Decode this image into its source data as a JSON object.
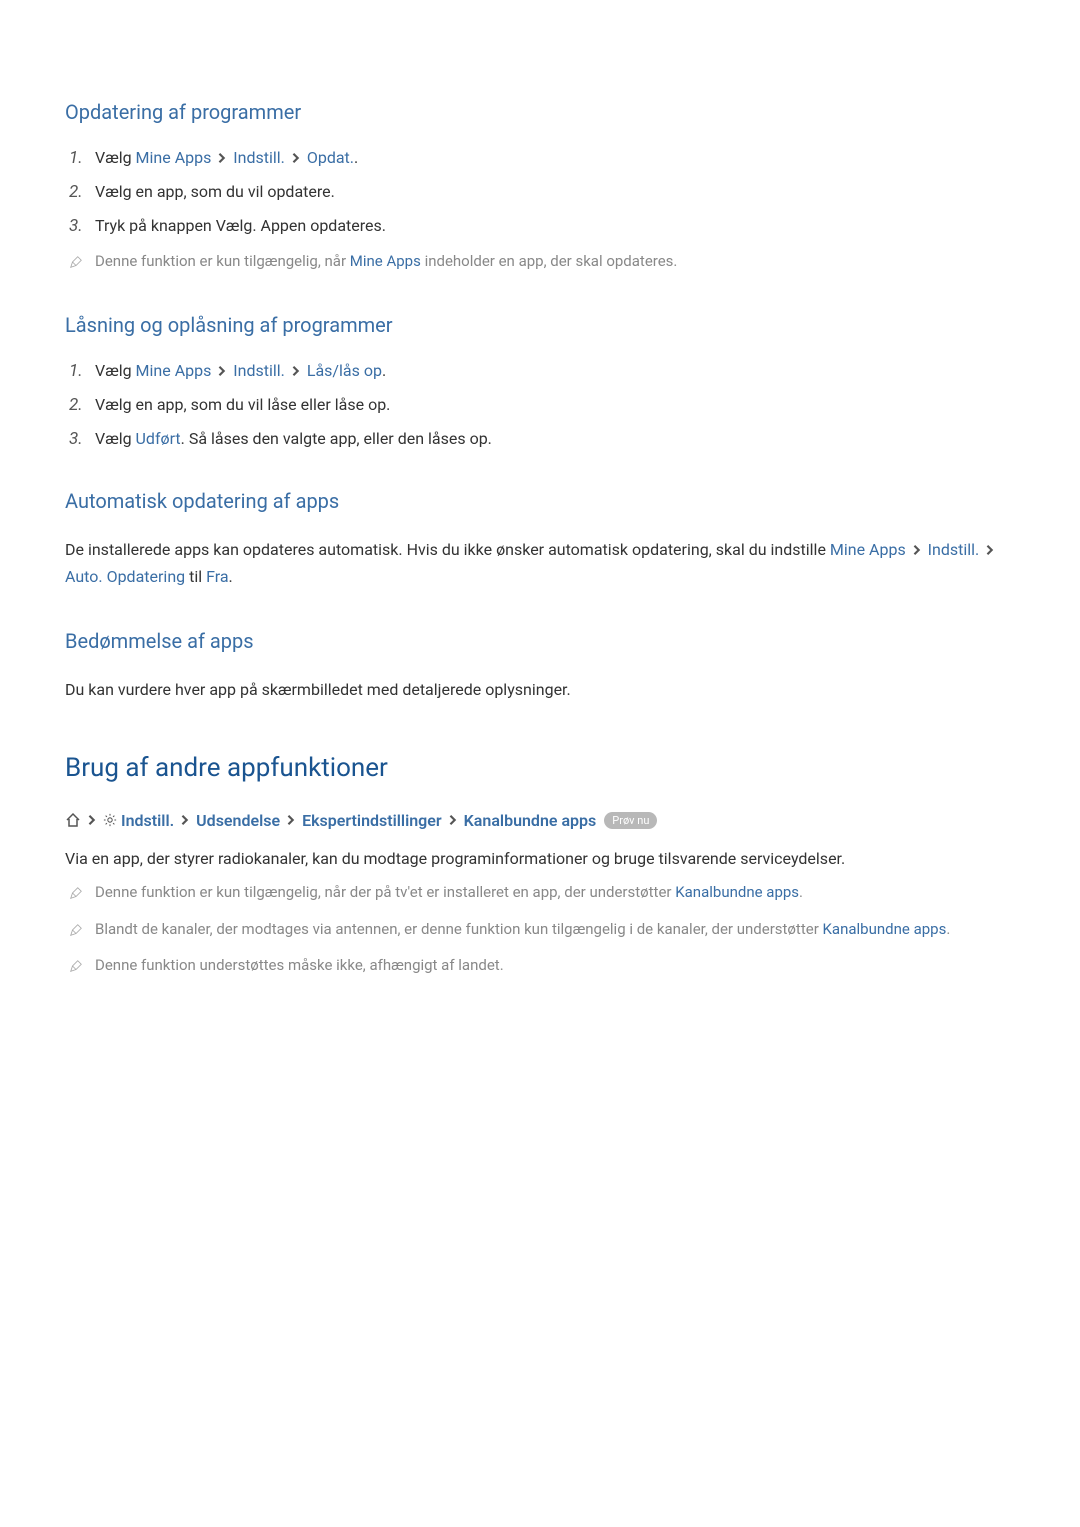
{
  "sections": {
    "update": {
      "heading": "Opdatering af programmer",
      "step1": {
        "num": "1.",
        "prefix": "Vælg ",
        "link1": "Mine Apps",
        "link2": "Indstill.",
        "link3": "Opdat."
      },
      "step2": {
        "num": "2.",
        "text": "Vælg en app, som du vil opdatere."
      },
      "step3": {
        "num": "3.",
        "text": "Tryk på knappen Vælg. Appen opdateres."
      },
      "note": {
        "prefix": "Denne funktion er kun tilgængelig, når ",
        "link": "Mine Apps",
        "suffix": " indeholder en app, der skal opdateres."
      }
    },
    "lock": {
      "heading": "Låsning og oplåsning af programmer",
      "step1": {
        "num": "1.",
        "prefix": "Vælg ",
        "link1": "Mine Apps",
        "link2": "Indstill.",
        "link3": "Lås/lås op",
        "suffix": "."
      },
      "step2": {
        "num": "2.",
        "text": "Vælg en app, som du vil låse eller låse op."
      },
      "step3": {
        "num": "3.",
        "prefix": "Vælg ",
        "link": "Udført",
        "suffix": ". Så låses den valgte app, eller den låses op."
      }
    },
    "auto": {
      "heading": "Automatisk opdatering af apps",
      "body": {
        "prefix": "De installerede apps kan opdateres automatisk. Hvis du ikke ønsker automatisk opdatering, skal du indstille ",
        "link1": "Mine Apps",
        "link2": "Indstill.",
        "link3": "Auto. Opdatering",
        "middle": " til ",
        "link4": "Fra",
        "suffix": "."
      }
    },
    "rating": {
      "heading": "Bedømmelse af apps",
      "body": "Du kan vurdere hver app på skærmbilledet med detaljerede oplysninger."
    },
    "other": {
      "heading": "Brug af andre appfunktioner",
      "breadcrumb": {
        "link1": "Indstill.",
        "link2": "Udsendelse",
        "link3": "Ekspertindstillinger",
        "link4": "Kanalbundne apps",
        "badge": "Prøv nu"
      },
      "body": "Via en app, der styrer radiokanaler, kan du modtage programinformationer og bruge tilsvarende serviceydelser.",
      "note1": {
        "prefix": "Denne funktion er kun tilgængelig, når der på tv'et er installeret en app, der understøtter ",
        "link": "Kanalbundne apps",
        "suffix": "."
      },
      "note2": {
        "prefix": "Blandt de kanaler, der modtages via antennen, er denne funktion kun tilgængelig i de kanaler, der understøtter ",
        "link": "Kanalbundne apps",
        "suffix": "."
      },
      "note3": "Denne funktion understøttes måske ikke, afhængigt af landet."
    }
  }
}
